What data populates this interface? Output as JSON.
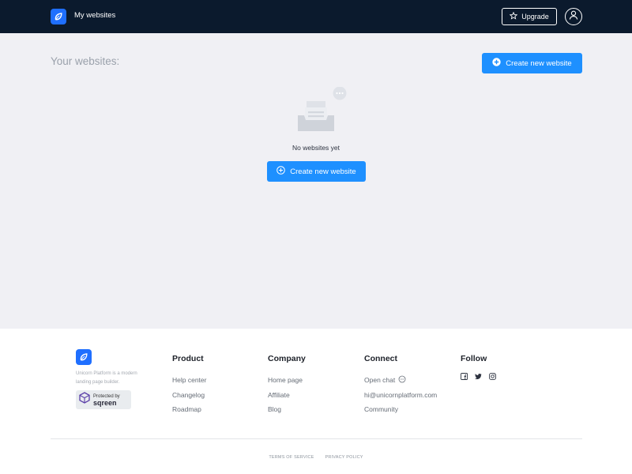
{
  "header": {
    "title": "My websites",
    "upgrade_label": "Upgrade",
    "logo_icon": "unicorn-logo-icon",
    "avatar_icon": "user-icon"
  },
  "main": {
    "page_title": "Your websites:",
    "create_button_label": "Create new website",
    "empty_state_text": "No websites yet",
    "empty_create_button_label": "Create new website"
  },
  "footer": {
    "description": "Unicorn Platform is a modern landing page builder.",
    "badge": {
      "small": "Protected by",
      "big": "sqreen"
    },
    "columns": [
      {
        "heading": "Product",
        "links": [
          "Help center",
          "Changelog",
          "Roadmap"
        ]
      },
      {
        "heading": "Company",
        "links": [
          "Home page",
          "Affiliate",
          "Blog"
        ]
      },
      {
        "heading": "Connect",
        "links": [
          "Open chat",
          "hi@unicornplatform.com",
          "Community"
        ]
      },
      {
        "heading": "Follow",
        "links": []
      }
    ],
    "social_icons": [
      "facebook-icon",
      "twitter-icon",
      "instagram-icon"
    ],
    "legal": {
      "terms": "TERMS OF SERVICE",
      "privacy": "PRIVACY POLICY"
    }
  },
  "colors": {
    "navbar": "#0b1a2d",
    "accent": "#1e90ff",
    "main_bg": "#f0f0f4",
    "logo_bg": "#1f6fff"
  }
}
